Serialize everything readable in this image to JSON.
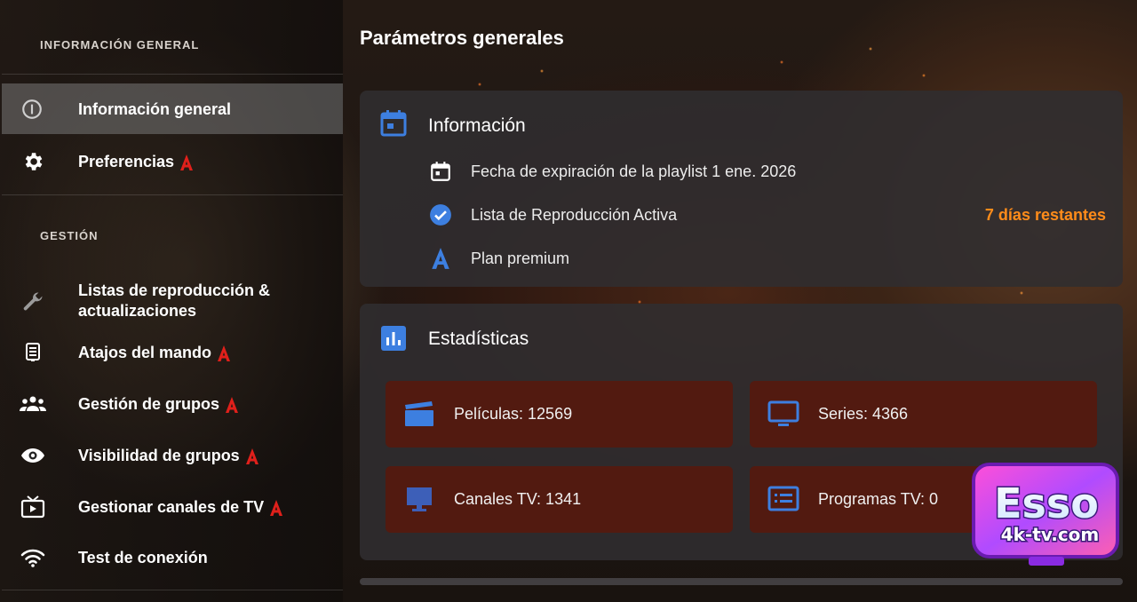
{
  "sidebar": {
    "section_general": "INFORMACIÓN GENERAL",
    "section_management": "GESTIÓN",
    "items": [
      {
        "label": "Información general",
        "icon": "info-icon",
        "active": true,
        "premium": false
      },
      {
        "label": "Preferencias",
        "icon": "gear-icon",
        "active": false,
        "premium": true
      },
      {
        "label": "Listas de reproducción & actualizaciones",
        "icon": "wrench-icon",
        "active": false,
        "premium": false
      },
      {
        "label": "Atajos del mando",
        "icon": "remote-icon",
        "active": false,
        "premium": true
      },
      {
        "label": "Gestión de grupos",
        "icon": "groups-icon",
        "active": false,
        "premium": true
      },
      {
        "label": "Visibilidad de grupos",
        "icon": "eye-icon",
        "active": false,
        "premium": true
      },
      {
        "label": "Gestionar canales de TV",
        "icon": "tv-icon",
        "active": false,
        "premium": true
      },
      {
        "label": "Test de conexión",
        "icon": "wifi-icon",
        "active": false,
        "premium": false
      }
    ]
  },
  "main": {
    "title": "Parámetros generales",
    "info_card": {
      "title": "Información",
      "rows": [
        {
          "icon": "calendar-icon",
          "text": "Fecha de expiración de la playlist 1 ene. 2026",
          "right": ""
        },
        {
          "icon": "check-circle-icon",
          "text": "Lista de Reproducción Activa",
          "right": "7 días restantes"
        },
        {
          "icon": "premium-a-icon",
          "text": "Plan premium",
          "right": ""
        }
      ]
    },
    "stats_card": {
      "title": "Estadísticas",
      "items": [
        {
          "icon": "movie-icon",
          "text": "Películas: 12569"
        },
        {
          "icon": "monitor-icon",
          "text": "Series: 4366"
        },
        {
          "icon": "desktop-icon",
          "text": "Canales TV: 1341"
        },
        {
          "icon": "guide-list-icon",
          "text": "Programas TV: 0"
        }
      ]
    }
  },
  "watermark": {
    "brand": "Esso",
    "domain": "4k-tv.com"
  },
  "colors": {
    "accent_blue": "#3d7fe0",
    "premium_red": "#e0201b",
    "days_orange": "#ff8c1a",
    "stat_tile": "#521a10"
  }
}
